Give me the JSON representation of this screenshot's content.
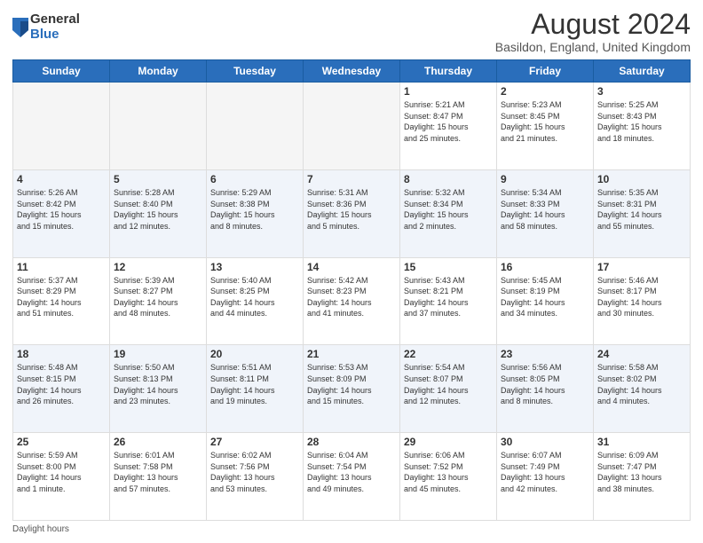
{
  "logo": {
    "general": "General",
    "blue": "Blue"
  },
  "header": {
    "title": "August 2024",
    "subtitle": "Basildon, England, United Kingdom"
  },
  "days_of_week": [
    "Sunday",
    "Monday",
    "Tuesday",
    "Wednesday",
    "Thursday",
    "Friday",
    "Saturday"
  ],
  "weeks": [
    [
      {
        "num": "",
        "info": "",
        "empty": true
      },
      {
        "num": "",
        "info": "",
        "empty": true
      },
      {
        "num": "",
        "info": "",
        "empty": true
      },
      {
        "num": "",
        "info": "",
        "empty": true
      },
      {
        "num": "1",
        "info": "Sunrise: 5:21 AM\nSunset: 8:47 PM\nDaylight: 15 hours\nand 25 minutes."
      },
      {
        "num": "2",
        "info": "Sunrise: 5:23 AM\nSunset: 8:45 PM\nDaylight: 15 hours\nand 21 minutes."
      },
      {
        "num": "3",
        "info": "Sunrise: 5:25 AM\nSunset: 8:43 PM\nDaylight: 15 hours\nand 18 minutes."
      }
    ],
    [
      {
        "num": "4",
        "info": "Sunrise: 5:26 AM\nSunset: 8:42 PM\nDaylight: 15 hours\nand 15 minutes."
      },
      {
        "num": "5",
        "info": "Sunrise: 5:28 AM\nSunset: 8:40 PM\nDaylight: 15 hours\nand 12 minutes."
      },
      {
        "num": "6",
        "info": "Sunrise: 5:29 AM\nSunset: 8:38 PM\nDaylight: 15 hours\nand 8 minutes."
      },
      {
        "num": "7",
        "info": "Sunrise: 5:31 AM\nSunset: 8:36 PM\nDaylight: 15 hours\nand 5 minutes."
      },
      {
        "num": "8",
        "info": "Sunrise: 5:32 AM\nSunset: 8:34 PM\nDaylight: 15 hours\nand 2 minutes."
      },
      {
        "num": "9",
        "info": "Sunrise: 5:34 AM\nSunset: 8:33 PM\nDaylight: 14 hours\nand 58 minutes."
      },
      {
        "num": "10",
        "info": "Sunrise: 5:35 AM\nSunset: 8:31 PM\nDaylight: 14 hours\nand 55 minutes."
      }
    ],
    [
      {
        "num": "11",
        "info": "Sunrise: 5:37 AM\nSunset: 8:29 PM\nDaylight: 14 hours\nand 51 minutes."
      },
      {
        "num": "12",
        "info": "Sunrise: 5:39 AM\nSunset: 8:27 PM\nDaylight: 14 hours\nand 48 minutes."
      },
      {
        "num": "13",
        "info": "Sunrise: 5:40 AM\nSunset: 8:25 PM\nDaylight: 14 hours\nand 44 minutes."
      },
      {
        "num": "14",
        "info": "Sunrise: 5:42 AM\nSunset: 8:23 PM\nDaylight: 14 hours\nand 41 minutes."
      },
      {
        "num": "15",
        "info": "Sunrise: 5:43 AM\nSunset: 8:21 PM\nDaylight: 14 hours\nand 37 minutes."
      },
      {
        "num": "16",
        "info": "Sunrise: 5:45 AM\nSunset: 8:19 PM\nDaylight: 14 hours\nand 34 minutes."
      },
      {
        "num": "17",
        "info": "Sunrise: 5:46 AM\nSunset: 8:17 PM\nDaylight: 14 hours\nand 30 minutes."
      }
    ],
    [
      {
        "num": "18",
        "info": "Sunrise: 5:48 AM\nSunset: 8:15 PM\nDaylight: 14 hours\nand 26 minutes."
      },
      {
        "num": "19",
        "info": "Sunrise: 5:50 AM\nSunset: 8:13 PM\nDaylight: 14 hours\nand 23 minutes."
      },
      {
        "num": "20",
        "info": "Sunrise: 5:51 AM\nSunset: 8:11 PM\nDaylight: 14 hours\nand 19 minutes."
      },
      {
        "num": "21",
        "info": "Sunrise: 5:53 AM\nSunset: 8:09 PM\nDaylight: 14 hours\nand 15 minutes."
      },
      {
        "num": "22",
        "info": "Sunrise: 5:54 AM\nSunset: 8:07 PM\nDaylight: 14 hours\nand 12 minutes."
      },
      {
        "num": "23",
        "info": "Sunrise: 5:56 AM\nSunset: 8:05 PM\nDaylight: 14 hours\nand 8 minutes."
      },
      {
        "num": "24",
        "info": "Sunrise: 5:58 AM\nSunset: 8:02 PM\nDaylight: 14 hours\nand 4 minutes."
      }
    ],
    [
      {
        "num": "25",
        "info": "Sunrise: 5:59 AM\nSunset: 8:00 PM\nDaylight: 14 hours\nand 1 minute."
      },
      {
        "num": "26",
        "info": "Sunrise: 6:01 AM\nSunset: 7:58 PM\nDaylight: 13 hours\nand 57 minutes."
      },
      {
        "num": "27",
        "info": "Sunrise: 6:02 AM\nSunset: 7:56 PM\nDaylight: 13 hours\nand 53 minutes."
      },
      {
        "num": "28",
        "info": "Sunrise: 6:04 AM\nSunset: 7:54 PM\nDaylight: 13 hours\nand 49 minutes."
      },
      {
        "num": "29",
        "info": "Sunrise: 6:06 AM\nSunset: 7:52 PM\nDaylight: 13 hours\nand 45 minutes."
      },
      {
        "num": "30",
        "info": "Sunrise: 6:07 AM\nSunset: 7:49 PM\nDaylight: 13 hours\nand 42 minutes."
      },
      {
        "num": "31",
        "info": "Sunrise: 6:09 AM\nSunset: 7:47 PM\nDaylight: 13 hours\nand 38 minutes."
      }
    ]
  ],
  "footer": {
    "label": "Daylight hours"
  }
}
